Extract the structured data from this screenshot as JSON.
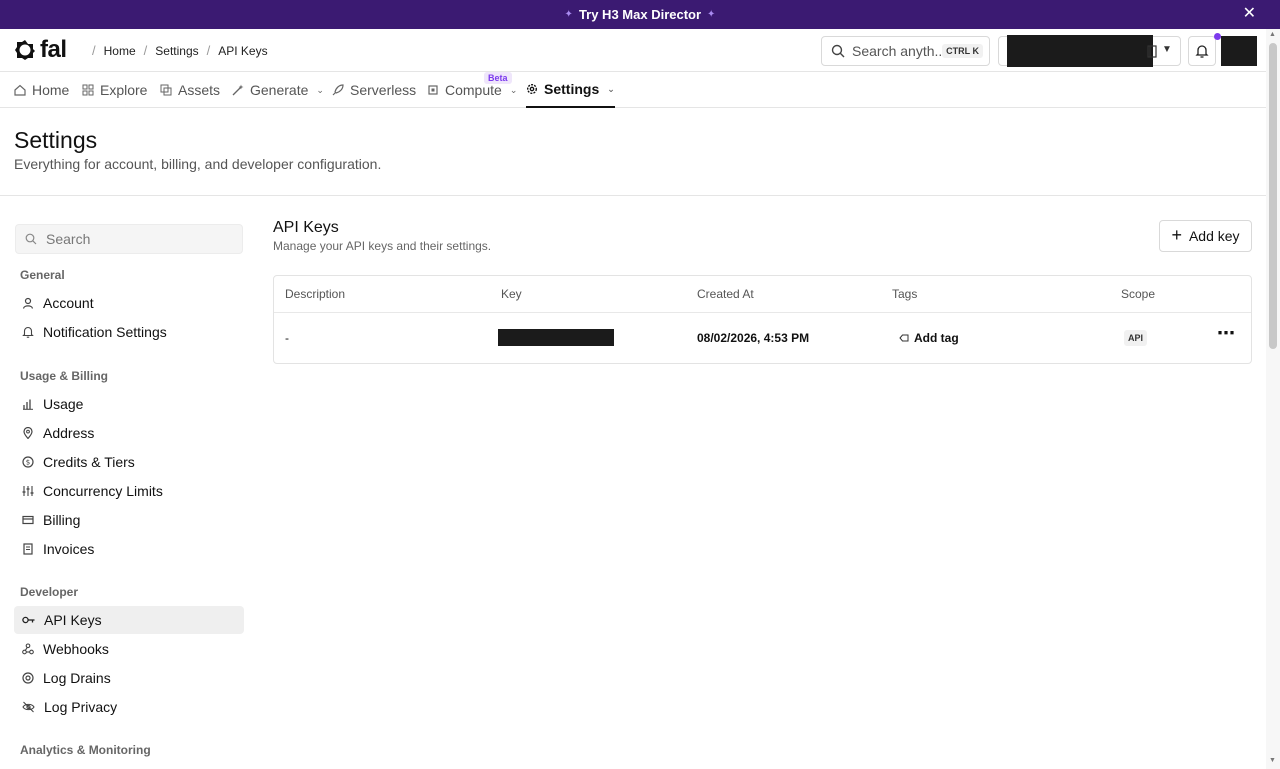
{
  "promo": {
    "text": "Try H3 Max Director"
  },
  "header": {
    "breadcrumbs": [
      "Home",
      "Settings",
      "API Keys"
    ],
    "search_placeholder": "Search anyth...",
    "shortcut": "CTRL K"
  },
  "nav": {
    "tabs": [
      {
        "label": "Home",
        "icon": "home-icon"
      },
      {
        "label": "Explore",
        "icon": "grid-icon"
      },
      {
        "label": "Assets",
        "icon": "layers-icon"
      },
      {
        "label": "Generate",
        "icon": "wand-icon"
      },
      {
        "label": "Serverless",
        "icon": "rocket-icon"
      },
      {
        "label": "Compute",
        "icon": "chip-icon"
      },
      {
        "label": "Settings",
        "icon": "gear-icon"
      }
    ],
    "beta_label": "Beta",
    "active_tab": "Settings"
  },
  "page": {
    "title": "Settings",
    "subtitle": "Everything for account, billing, and developer configuration."
  },
  "sidebar": {
    "search_placeholder": "Search",
    "groups": [
      {
        "label": "General",
        "items": [
          "Account",
          "Notification Settings"
        ]
      },
      {
        "label": "Usage & Billing",
        "items": [
          "Usage",
          "Address",
          "Credits & Tiers",
          "Concurrency Limits",
          "Billing",
          "Invoices"
        ]
      },
      {
        "label": "Developer",
        "items": [
          "API Keys",
          "Webhooks",
          "Log Drains",
          "Log Privacy"
        ]
      },
      {
        "label": "Analytics & Monitoring",
        "items": []
      }
    ],
    "active_item": "API Keys"
  },
  "section": {
    "title": "API Keys",
    "subtitle": "Manage your API keys and their settings.",
    "add_button": "Add key"
  },
  "table": {
    "columns": [
      "Description",
      "Key",
      "Created At",
      "Tags",
      "Scope"
    ],
    "rows": [
      {
        "description": "-",
        "key": "",
        "created_at": "08/02/2026, 4:53 PM",
        "tags_action": "Add tag",
        "scope": "API"
      }
    ]
  },
  "colors": {
    "promo_bg": "#3b1a72",
    "accent": "#7c3aed",
    "text": "#111111",
    "muted": "#555555"
  }
}
